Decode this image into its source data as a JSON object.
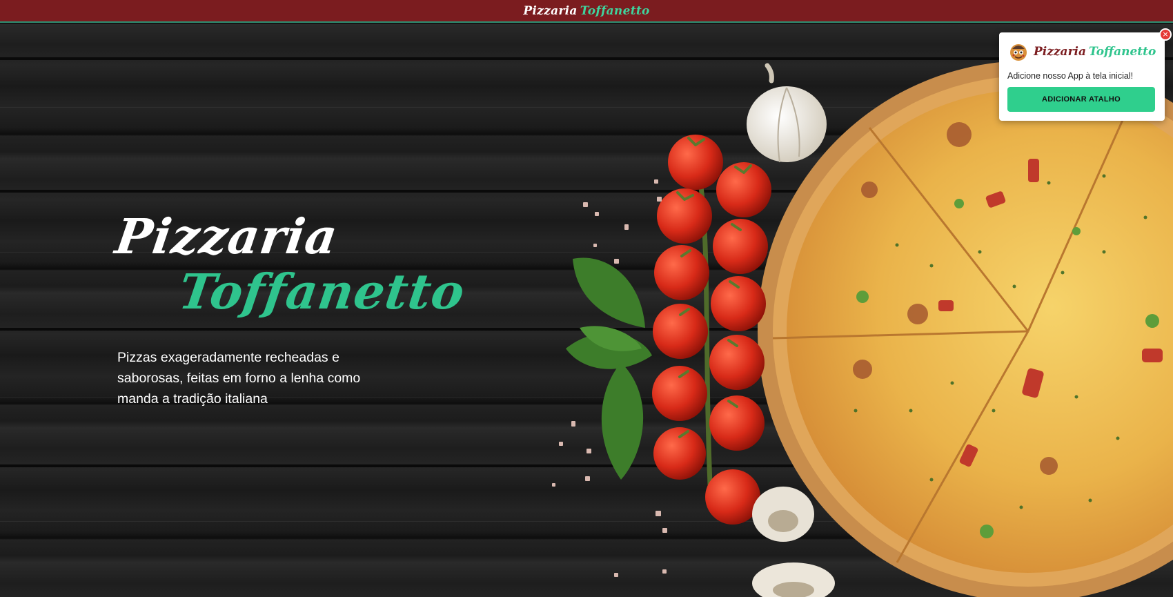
{
  "topbar": {
    "logo_word1": "Pizzaria",
    "logo_word2": "Toffanetto"
  },
  "hero": {
    "title_line1": "Pizzaria",
    "title_line2": "Toffanetto",
    "description": "Pizzas exageradamente recheadas e saborosas, feitas em forno a lenha como manda a tradição italiana"
  },
  "pwa_prompt": {
    "logo_word1": "Pizzaria",
    "logo_word2": "Toffanetto",
    "message": "Adicione nosso App à tela inicial!",
    "button_label": "ADICIONAR ATALHO",
    "close_symbol": "×"
  },
  "icons": {
    "close": "close-icon",
    "mascot": "pizza-mascot-icon"
  },
  "colors": {
    "topbar_bg": "#7b1c1f",
    "brand_green": "#2fc48d",
    "button_green": "#2fcf8d",
    "close_red": "#e53935"
  }
}
